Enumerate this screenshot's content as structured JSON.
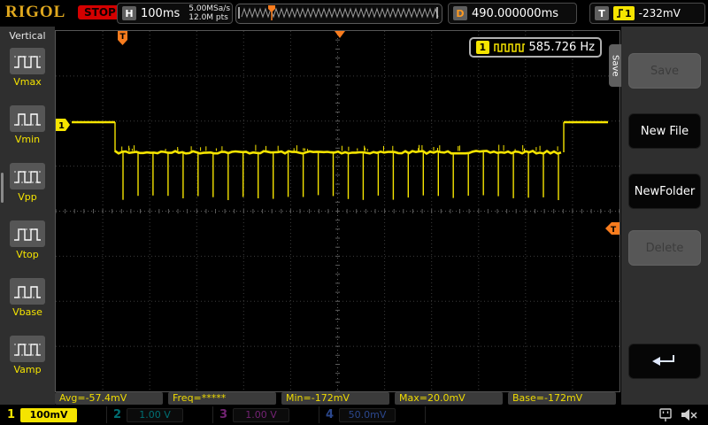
{
  "top_bar": {
    "logo": "RIGOL",
    "run_state": "STOP",
    "horizontal_label": "H",
    "timebase": "100ms",
    "sample_rate": "5.00MSa/s",
    "memory_depth": "12.0M pts",
    "delay_label": "D",
    "delay_value": "490.000000ms",
    "trigger_label": "T",
    "trigger_source": "1",
    "trigger_level": "-232mV"
  },
  "left_menu": {
    "title": "Vertical",
    "items": [
      {
        "label": "Vmax"
      },
      {
        "label": "Vmin"
      },
      {
        "label": "Vpp"
      },
      {
        "label": "Vtop"
      },
      {
        "label": "Vbase"
      },
      {
        "label": "Vamp"
      }
    ]
  },
  "freq_counter": {
    "channel": "1",
    "value": "585.726 Hz"
  },
  "right_menu": {
    "tab_label": "Save",
    "save_label": "Save",
    "new_file_label": "New File",
    "new_folder_label": "NewFolder",
    "delete_label": "Delete"
  },
  "measurements": [
    "Avg=-57.4mV",
    "Freq=*****",
    "Min=-172mV",
    "Max=20.0mV",
    "Base=-172mV"
  ],
  "channels": [
    {
      "number": "1",
      "scale": "100mV",
      "active": true
    },
    {
      "number": "2",
      "scale": "1.00 V",
      "active": false
    },
    {
      "number": "3",
      "scale": "1.00 V",
      "active": false
    },
    {
      "number": "4",
      "scale": "50.0mV",
      "active": false
    }
  ],
  "colors": {
    "ch1": "#f5e400",
    "ch2": "#00c8d0",
    "ch3": "#d040d0",
    "ch4": "#4f81ff",
    "trigger": "#f87c1e",
    "grid": "#3c3c3c",
    "grid_center": "#5a5a5a"
  },
  "chart_data": {
    "type": "line",
    "title": "CH1 trace",
    "time_per_div": "100ms",
    "volts_per_div_mV": 100,
    "description": "Square-topped trace: high ~20mV for ~1.3 div at left and ~1 div at right, middle section sits near -60mV with 30 narrow negative pulses reaching -172mV",
    "levels_mV": {
      "high": 20.0,
      "mid_band": -57.4,
      "pulse_bottom": -172.0
    },
    "pulse_count": 30,
    "counter_frequency_hz": 585.726,
    "measurements": {
      "Avg": "-57.4mV",
      "Freq": "*****",
      "Min": "-172mV",
      "Max": "20.0mV",
      "Base": "-172mV"
    }
  }
}
